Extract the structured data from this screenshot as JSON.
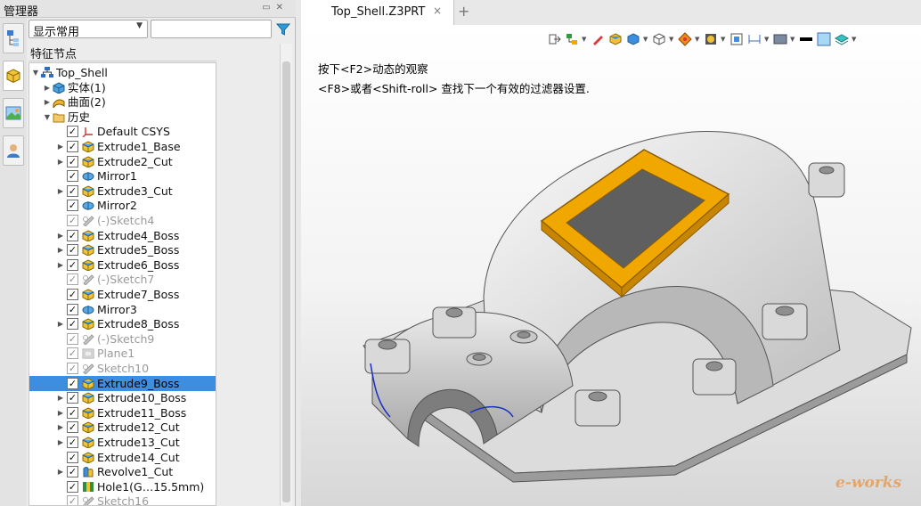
{
  "manager": {
    "title": "管理器",
    "display_mode": "显示常用",
    "filter_value": "",
    "tree_header": "特征节点",
    "icons": {
      "pin": "pin-icon",
      "close": "close-icon",
      "filter": "filter-icon"
    }
  },
  "side_tabs": [
    "part-cube-icon",
    "image-view-icon",
    "user-icon"
  ],
  "tree": [
    {
      "label": "Top_Shell",
      "level": 0,
      "expand": "open",
      "check": null,
      "icon": "assembly",
      "dim": false
    },
    {
      "label": "实体(1)",
      "level": 1,
      "expand": "closed",
      "check": null,
      "icon": "solid",
      "dim": false
    },
    {
      "label": "曲面(2)",
      "level": 1,
      "expand": "closed",
      "check": null,
      "icon": "surface",
      "dim": false
    },
    {
      "label": "历史",
      "level": 1,
      "expand": "open",
      "check": null,
      "icon": "folder",
      "dim": false
    },
    {
      "label": "Default CSYS",
      "level": 2,
      "expand": null,
      "check": true,
      "icon": "csys",
      "dim": false
    },
    {
      "label": "Extrude1_Base",
      "level": 2,
      "expand": "closed",
      "check": true,
      "icon": "extrude",
      "dim": false
    },
    {
      "label": "Extrude2_Cut",
      "level": 2,
      "expand": "closed",
      "check": true,
      "icon": "extrude",
      "dim": false
    },
    {
      "label": "Mirror1",
      "level": 2,
      "expand": null,
      "check": true,
      "icon": "mirror",
      "dim": false
    },
    {
      "label": "Extrude3_Cut",
      "level": 2,
      "expand": "closed",
      "check": true,
      "icon": "extrude",
      "dim": false
    },
    {
      "label": "Mirror2",
      "level": 2,
      "expand": null,
      "check": true,
      "icon": "mirror",
      "dim": false
    },
    {
      "label": "(-)Sketch4",
      "level": 2,
      "expand": null,
      "check": true,
      "icon": "sketch",
      "dim": true
    },
    {
      "label": "Extrude4_Boss",
      "level": 2,
      "expand": "closed",
      "check": true,
      "icon": "extrude",
      "dim": false
    },
    {
      "label": "Extrude5_Boss",
      "level": 2,
      "expand": "closed",
      "check": true,
      "icon": "extrude",
      "dim": false
    },
    {
      "label": "Extrude6_Boss",
      "level": 2,
      "expand": "closed",
      "check": true,
      "icon": "extrude",
      "dim": false
    },
    {
      "label": "(-)Sketch7",
      "level": 2,
      "expand": null,
      "check": true,
      "icon": "sketch",
      "dim": true
    },
    {
      "label": "Extrude7_Boss",
      "level": 2,
      "expand": null,
      "check": true,
      "icon": "extrude",
      "dim": false
    },
    {
      "label": "Mirror3",
      "level": 2,
      "expand": null,
      "check": true,
      "icon": "mirror",
      "dim": false
    },
    {
      "label": "Extrude8_Boss",
      "level": 2,
      "expand": "closed",
      "check": true,
      "icon": "extrude",
      "dim": false
    },
    {
      "label": "(-)Sketch9",
      "level": 2,
      "expand": null,
      "check": true,
      "icon": "sketch",
      "dim": true
    },
    {
      "label": "Plane1",
      "level": 2,
      "expand": null,
      "check": true,
      "icon": "plane",
      "dim": true
    },
    {
      "label": "Sketch10",
      "level": 2,
      "expand": null,
      "check": true,
      "icon": "sketch",
      "dim": true
    },
    {
      "label": "Extrude9_Boss",
      "level": 2,
      "expand": null,
      "check": true,
      "icon": "extrude",
      "dim": false,
      "selected": true
    },
    {
      "label": "Extrude10_Boss",
      "level": 2,
      "expand": "closed",
      "check": true,
      "icon": "extrude",
      "dim": false
    },
    {
      "label": "Extrude11_Boss",
      "level": 2,
      "expand": "closed",
      "check": true,
      "icon": "extrude",
      "dim": false
    },
    {
      "label": "Extrude12_Cut",
      "level": 2,
      "expand": "closed",
      "check": true,
      "icon": "extrude",
      "dim": false
    },
    {
      "label": "Extrude13_Cut",
      "level": 2,
      "expand": "closed",
      "check": true,
      "icon": "extrude",
      "dim": false
    },
    {
      "label": "Extrude14_Cut",
      "level": 2,
      "expand": null,
      "check": true,
      "icon": "extrude",
      "dim": false
    },
    {
      "label": "Revolve1_Cut",
      "level": 2,
      "expand": "closed",
      "check": true,
      "icon": "revolve",
      "dim": false
    },
    {
      "label": "Hole1(G…15.5mm)",
      "level": 2,
      "expand": null,
      "check": true,
      "icon": "hole",
      "dim": false
    },
    {
      "label": "Sketch16",
      "level": 2,
      "expand": null,
      "check": true,
      "icon": "sketch",
      "dim": true
    }
  ],
  "document": {
    "tab_label": "Top_Shell.Z3PRT",
    "close": "×",
    "add": "+"
  },
  "viewport": {
    "hint_line1": "按下<F2>动态的观察",
    "hint_line2": "<F8>或者<Shift-roll> 查找下一个有效的过滤器设置.",
    "watermark": "e-works",
    "toolbar": [
      {
        "icon": "exit-sketch-icon",
        "dd": false
      },
      {
        "icon": "hierarchy-icon",
        "dd": true
      },
      {
        "icon": "pencil-icon",
        "dd": false
      },
      {
        "icon": "shaded-cube-icon",
        "dd": false
      },
      {
        "icon": "cube-view-icon",
        "dd": true
      },
      {
        "icon": "wire-cube-icon",
        "dd": true
      },
      {
        "icon": "render-mode-icon",
        "dd": true
      },
      {
        "icon": "display-filter-icon",
        "dd": true
      },
      {
        "icon": "zoom-fit-icon",
        "dd": false
      },
      {
        "icon": "dimension-icon",
        "dd": true
      },
      {
        "icon": "background-icon",
        "dd": true
      },
      {
        "icon": "color-bar-icon",
        "dd": false
      },
      {
        "icon": "layer-icon",
        "dd": false
      },
      {
        "icon": "section-view-icon",
        "dd": true
      }
    ],
    "colors": {
      "highlight": "#f0a800",
      "selected_row": "#3d8ee0",
      "edge_highlight": "#1a2fc4"
    }
  }
}
